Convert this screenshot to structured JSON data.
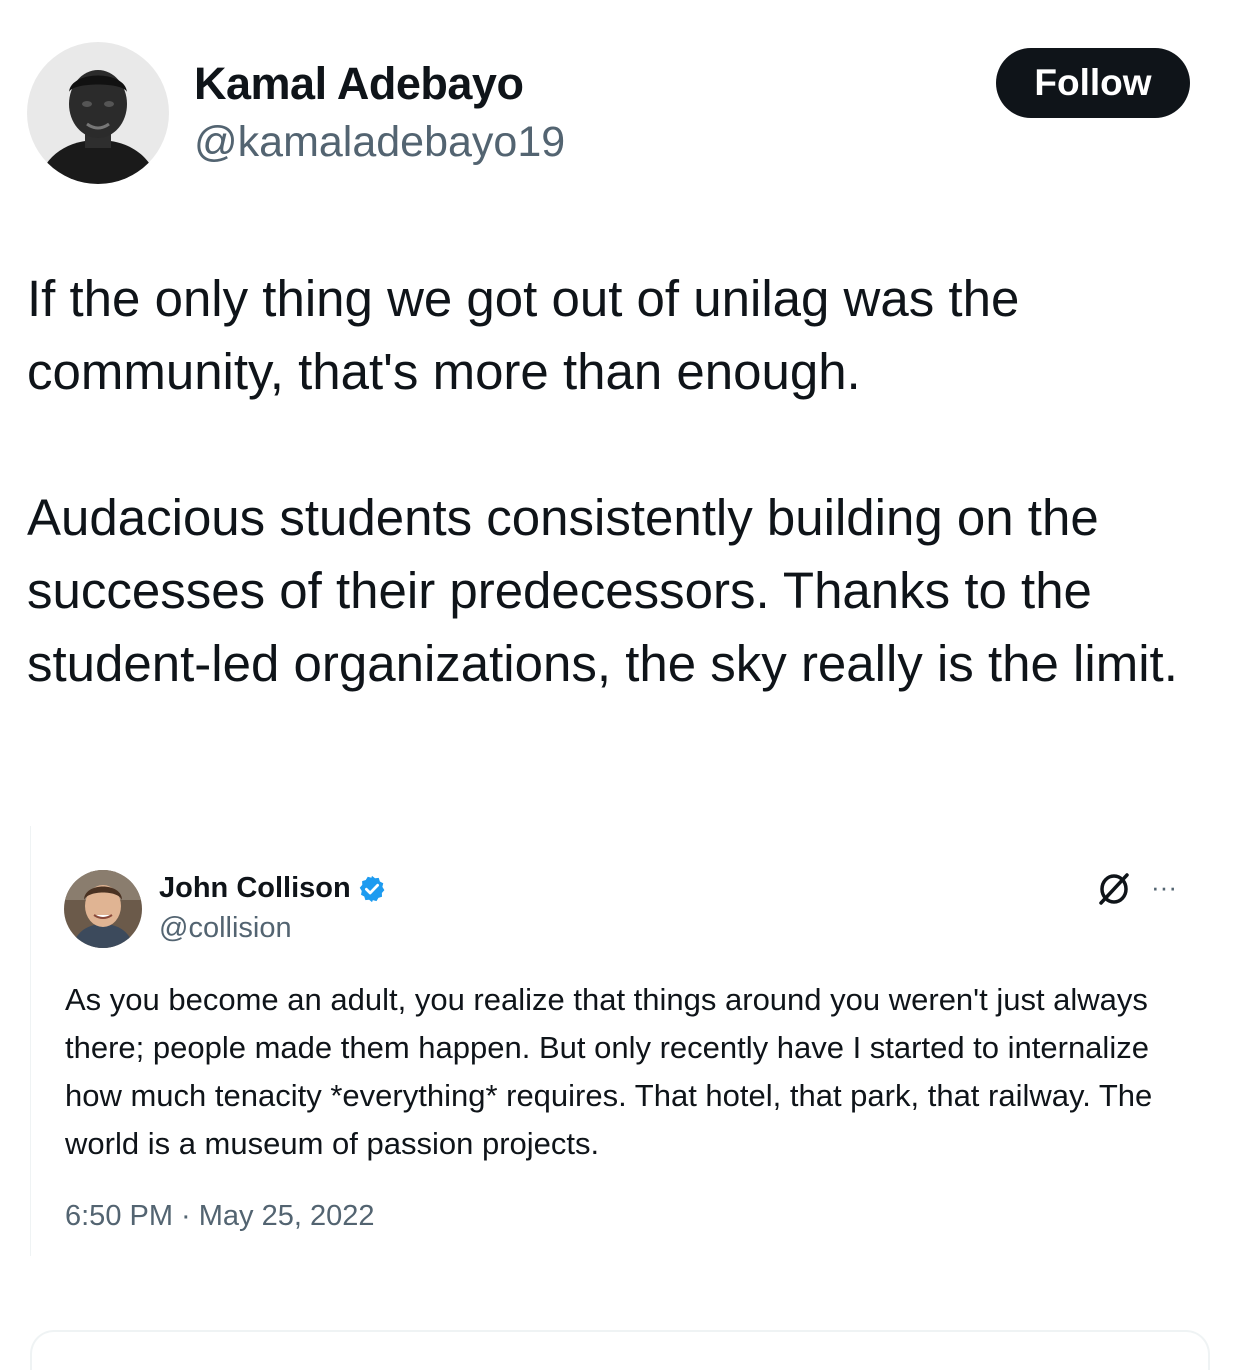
{
  "tweet": {
    "author": {
      "name": "Kamal Adebayo",
      "handle": "@kamaladebayo19",
      "avatar_icon": "user-avatar-photo"
    },
    "follow_label": "Follow",
    "text_paragraphs": [
      "If the only thing we got out of unilag was the community, that's more than enough.",
      "Audacious students consistently building on the successes of their predecessors. Thanks to the student-led organizations, the sky really is the limit."
    ]
  },
  "quoted_tweet": {
    "author": {
      "name": "John Collison",
      "handle": "@collision",
      "verified": true,
      "avatar_icon": "user-avatar-photo"
    },
    "text": "As you become an adult, you realize that things around you weren't just always there; people made them happen. But only recently have I started to internalize how much tenacity *everything* requires. That hotel, that park, that railway. The world is a museum of passion projects.",
    "timestamp": "6:50 PM · May 25, 2022",
    "more_label": "···"
  },
  "colors": {
    "primary_text": "#0f1419",
    "secondary_text": "#536471",
    "follow_bg": "#0f1419",
    "verified_blue": "#1d9bf0",
    "divider": "#eff3f4"
  }
}
